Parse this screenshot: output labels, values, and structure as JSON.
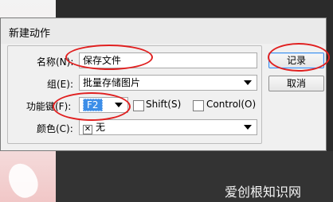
{
  "dialog": {
    "title": "新建动作",
    "close_glyph": "✕",
    "name_label": "名称(N):",
    "name_value": "保存文件",
    "group_label": "组(E):",
    "group_value": "批量存储图片",
    "fkey_label": "功能键(F):",
    "fkey_value": "F2",
    "shift_label": "Shift(S)",
    "control_label": "Control(O)",
    "color_label": "颜色(C):",
    "color_value": "无",
    "color_mark": "✕",
    "record_button": "记录",
    "cancel_button": "取消"
  },
  "watermark": "爱创根知识网",
  "colors": {
    "annotation": "#e02020",
    "selection": "#3d8ee8"
  }
}
